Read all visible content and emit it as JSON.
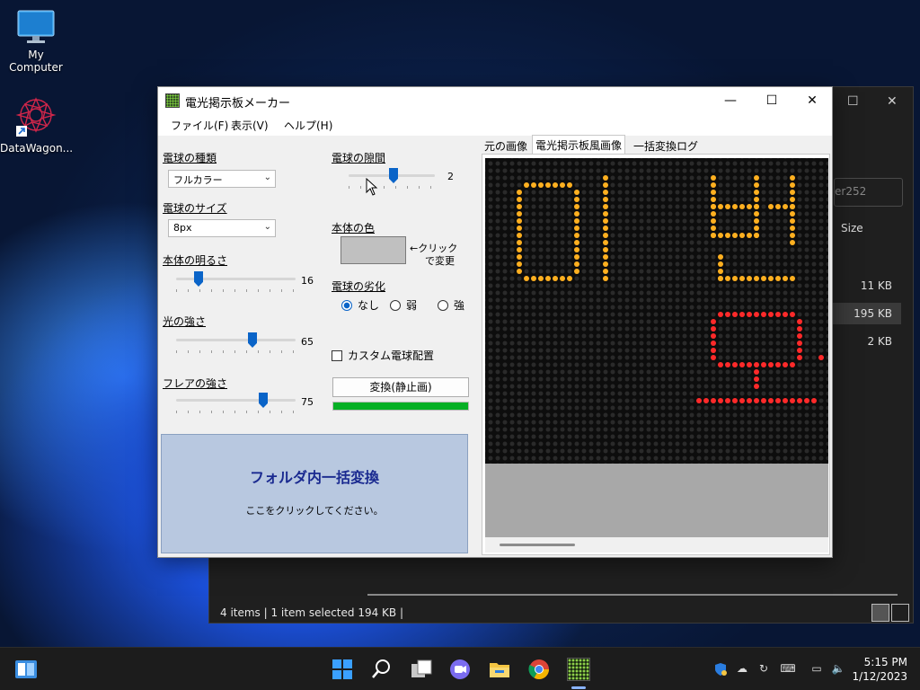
{
  "desktop": {
    "icons": [
      {
        "label": "My Computer"
      },
      {
        "label": "DataWagon..."
      }
    ]
  },
  "explorer": {
    "search_placeholder": "er252",
    "col_size": "Size",
    "rows": [
      "11 KB",
      "195 KB",
      "2 KB"
    ],
    "status": "4 items   |   1 item selected  194 KB   |"
  },
  "app": {
    "title": "電光掲示板メーカー",
    "menu": {
      "file": "ファイル(F)",
      "view": "表示(V)",
      "help": "ヘルプ(H)"
    },
    "bulb_type": {
      "label": "電球の種類",
      "value": "フルカラー"
    },
    "bulb_size": {
      "label": "電球のサイズ",
      "value": "8px"
    },
    "brightness": {
      "label": "本体の明るさ",
      "value": "16",
      "level": 16
    },
    "light": {
      "label": "光の強さ",
      "value": "65",
      "level": 65
    },
    "flare": {
      "label": "フレアの強さ",
      "value": "75",
      "level": 75
    },
    "gap": {
      "label": "電球の隙間",
      "value": "2",
      "level": 2
    },
    "body_color": {
      "label": "本体の色",
      "note_line1": "←クリック",
      "note_line2": "で変更",
      "color": "#c0c0c0"
    },
    "degrade": {
      "label": "電球の劣化",
      "none": "なし",
      "weak": "弱",
      "strong": "強",
      "selected": "なし"
    },
    "custom_layout": "カスタム電球配置",
    "convert_button": "変換(静止画)",
    "progress": 1.0,
    "batch": {
      "title": "フォルダ内一括変換",
      "hint": "ここをクリックしてください。"
    },
    "tabs": [
      "元の画像",
      "電光掲示板風画像",
      "一括変換ログ"
    ],
    "active_tab": "電光掲示板風画像",
    "led_colors": {
      "amber": "#ffb020",
      "red": "#ff2a2a",
      "off": "#2a2a2a"
    }
  },
  "taskbar": {
    "time": "5:15 PM",
    "date": "1/12/2023"
  }
}
